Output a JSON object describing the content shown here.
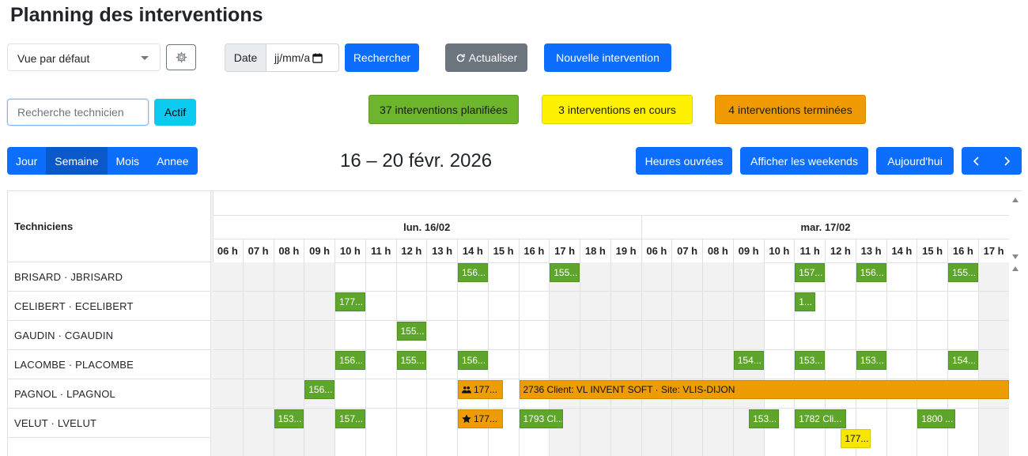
{
  "page_title": "Planning des interventions",
  "view_select": {
    "value": "Vue par défaut"
  },
  "date_filter": {
    "label": "Date",
    "placeholder": "jj/mm/a"
  },
  "buttons": {
    "search": "Rechercher",
    "refresh": "Actualiser",
    "new_intervention": "Nouvelle intervention",
    "active": "Actif",
    "business_hours": "Heures ouvrées",
    "show_weekends": "Afficher les weekends",
    "today": "Aujourd'hui"
  },
  "tech_search": {
    "placeholder": "Recherche technicien"
  },
  "status_badges": {
    "planned": {
      "label": "37 interventions planifiées",
      "color": "#6cb52d"
    },
    "in_progress": {
      "label": "3 interventions en cours",
      "color": "#fff200"
    },
    "done": {
      "label": "4 interventions terminées",
      "color": "#f09b04"
    }
  },
  "view_tabs": [
    "Jour",
    "Semaine",
    "Mois",
    "Annee"
  ],
  "active_view": "Semaine",
  "date_range": "16 – 20 févr. 2026",
  "scheduler": {
    "resource_header": "Techniciens",
    "days": [
      "lun. 16/02",
      "mar. 17/02"
    ],
    "hours_day1": [
      "06 h",
      "07 h",
      "08 h",
      "09 h",
      "10 h",
      "11 h",
      "12 h",
      "13 h",
      "14 h",
      "15 h",
      "16 h",
      "17 h",
      "18 h",
      "19 h"
    ],
    "hours_day2": [
      "06 h",
      "07 h",
      "08 h",
      "09 h",
      "10 h",
      "11 h",
      "12 h",
      "13 h",
      "14 h",
      "15 h",
      "16 h",
      "17 h"
    ],
    "technicians": [
      "BRISARD · JBRISARD",
      "CELIBERT · ECELIBERT",
      "GAUDIN · CGAUDIN",
      "LACOMBE · PLACOMBE",
      "PAGNOL · LPAGNOL",
      "VELUT · LVELUT"
    ],
    "events": [
      {
        "text": "156..."
      },
      {
        "text": "155..."
      },
      {
        "text": "157..."
      },
      {
        "text": "156..."
      },
      {
        "text": "155..."
      },
      {
        "text": "177..."
      },
      {
        "text": "1..."
      },
      {
        "text": "155..."
      },
      {
        "text": "156..."
      },
      {
        "text": "155..."
      },
      {
        "text": "156..."
      },
      {
        "text": "154..."
      },
      {
        "text": "153..."
      },
      {
        "text": "153..."
      },
      {
        "text": "154..."
      },
      {
        "text": "156..."
      },
      {
        "text": "177...",
        "icon": "users-icon"
      },
      {
        "text": "2736 Client: VL INVENT SOFT · Site: VLIS-DIJON"
      },
      {
        "text": "153..."
      },
      {
        "text": "157..."
      },
      {
        "text": "177...",
        "icon": "star-icon"
      },
      {
        "text": "1793 Cl..."
      },
      {
        "text": "153..."
      },
      {
        "text": "1782 Cli..."
      },
      {
        "text": "1800 ..."
      },
      {
        "text": "177..."
      }
    ]
  }
}
